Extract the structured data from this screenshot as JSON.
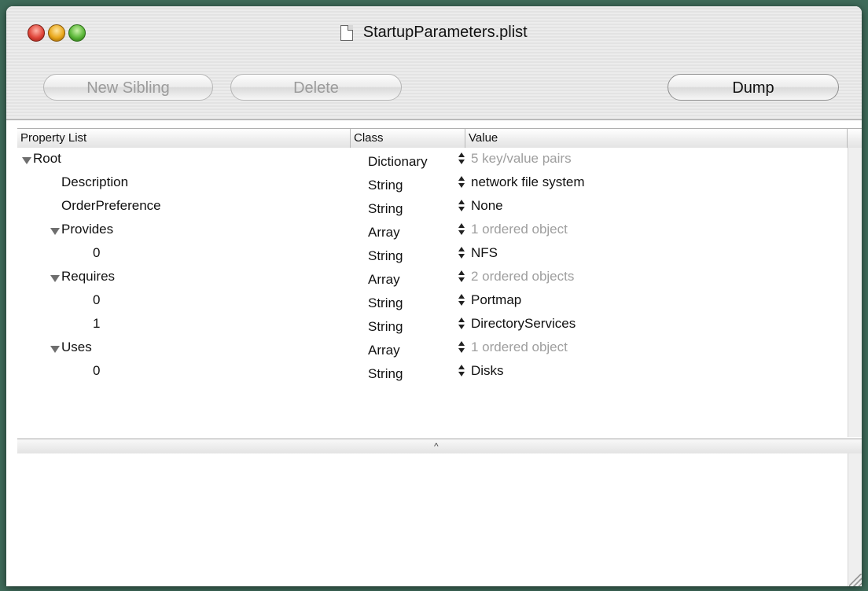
{
  "window": {
    "title": "StartupParameters.plist"
  },
  "toolbar": {
    "new_sibling_label": "New Sibling",
    "delete_label": "Delete",
    "dump_label": "Dump"
  },
  "columns": {
    "property_list": "Property List",
    "class": "Class",
    "value": "Value"
  },
  "rows": [
    {
      "key": "Root",
      "class": "Dictionary",
      "value": "5 key/value pairs",
      "expandable": true,
      "depth": 0,
      "dim": true
    },
    {
      "key": "Description",
      "class": "String",
      "value": "network file system",
      "expandable": false,
      "depth": 1,
      "dim": false
    },
    {
      "key": "OrderPreference",
      "class": "String",
      "value": "None",
      "expandable": false,
      "depth": 1,
      "dim": false
    },
    {
      "key": "Provides",
      "class": "Array",
      "value": "1 ordered object",
      "expandable": true,
      "depth": 1,
      "dim": true
    },
    {
      "key": "0",
      "class": "String",
      "value": "NFS",
      "expandable": false,
      "depth": 2,
      "dim": false
    },
    {
      "key": "Requires",
      "class": "Array",
      "value": "2 ordered objects",
      "expandable": true,
      "depth": 1,
      "dim": true
    },
    {
      "key": "0",
      "class": "String",
      "value": "Portmap",
      "expandable": false,
      "depth": 2,
      "dim": false
    },
    {
      "key": "1",
      "class": "String",
      "value": "DirectoryServices",
      "expandable": false,
      "depth": 2,
      "dim": false
    },
    {
      "key": "Uses",
      "class": "Array",
      "value": "1 ordered object",
      "expandable": true,
      "depth": 1,
      "dim": true
    },
    {
      "key": "0",
      "class": "String",
      "value": "Disks",
      "expandable": false,
      "depth": 2,
      "dim": false
    }
  ],
  "colors": {
    "desktop": "#3f6b5a",
    "dim_text": "#9e9e9e"
  }
}
